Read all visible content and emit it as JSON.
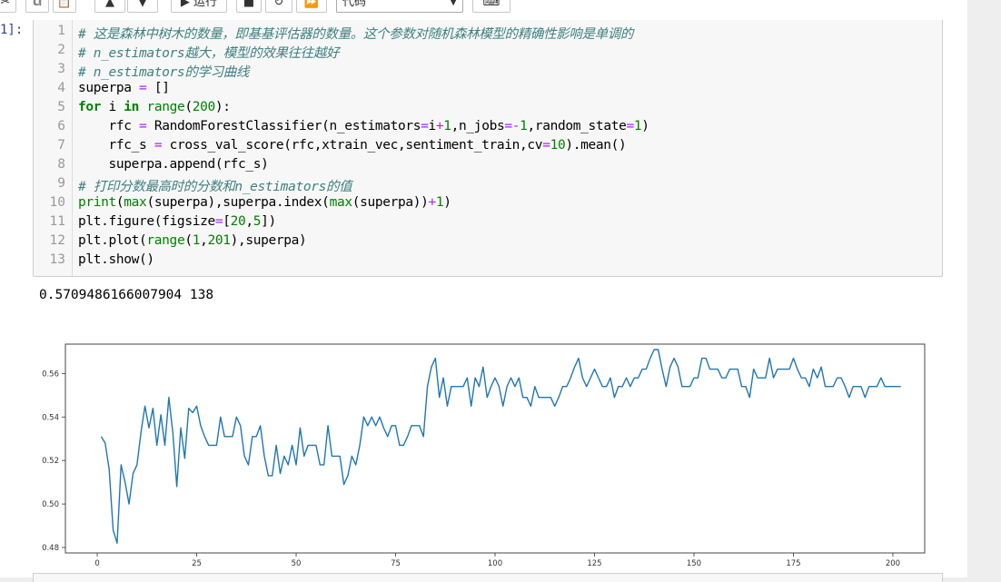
{
  "toolbar": {
    "run_label": "▶ 运行",
    "celltype_value": "代码",
    "buttons": [
      "cut-icon",
      "copy-icon",
      "paste-icon",
      "move-up-icon",
      "move-down-icon",
      "run",
      "stop-icon",
      "restart-icon",
      "fast-forward-icon",
      "keyboard-icon"
    ]
  },
  "cell": {
    "prompt": "1]:",
    "line_numbers": [
      "1",
      "2",
      "3",
      "4",
      "5",
      "6",
      "7",
      "8",
      "9",
      "10",
      "11",
      "12",
      "13"
    ],
    "code_lines": [
      "# 这是森林中树木的数量，即基基评估器的数量。这个参数对随机森林模型的精确性影响是单调的",
      "# n_estimators越大，模型的效果往往越好",
      "# n_estimators的学习曲线",
      "superpa = []",
      "for i in range(200):",
      "    rfc = RandomForestClassifier(n_estimators=i+1,n_jobs=-1,random_state=1)",
      "    rfc_s = cross_val_score(rfc,xtrain_vec,sentiment_train,cv=10).mean()",
      "    superpa.append(rfc_s)",
      "# 打印分数最高时的分数和n_estimators的值",
      "print(max(superpa),superpa.index(max(superpa))+1)",
      "plt.figure(figsize=[20,5])",
      "plt.plot(range(1,201),superpa)",
      "plt.show()"
    ],
    "output_text": "0.5709486166007904 138"
  },
  "chart_data": {
    "type": "line",
    "title": "",
    "xlabel": "",
    "ylabel": "",
    "xlim": [
      -8,
      208
    ],
    "ylim": [
      0.4775,
      0.5735
    ],
    "xticks": [
      "0",
      "25",
      "50",
      "75",
      "100",
      "125",
      "150",
      "175",
      "200"
    ],
    "yticks": [
      "0.48",
      "0.50",
      "0.52",
      "0.54",
      "0.56"
    ],
    "grid": false,
    "line_color": "#1f77b4",
    "series": [
      {
        "x_start": 1,
        "x_step": 1,
        "values": [
          0.531,
          0.528,
          0.516,
          0.488,
          0.482,
          0.518,
          0.51,
          0.5,
          0.514,
          0.518,
          0.533,
          0.545,
          0.535,
          0.544,
          0.527,
          0.541,
          0.527,
          0.549,
          0.533,
          0.508,
          0.535,
          0.521,
          0.544,
          0.542,
          0.545,
          0.536,
          0.531,
          0.527,
          0.527,
          0.527,
          0.54,
          0.531,
          0.531,
          0.531,
          0.54,
          0.536,
          0.522,
          0.518,
          0.531,
          0.531,
          0.536,
          0.522,
          0.513,
          0.513,
          0.527,
          0.514,
          0.522,
          0.518,
          0.527,
          0.518,
          0.535,
          0.522,
          0.527,
          0.527,
          0.527,
          0.518,
          0.518,
          0.536,
          0.522,
          0.522,
          0.522,
          0.509,
          0.513,
          0.522,
          0.518,
          0.527,
          0.54,
          0.536,
          0.54,
          0.536,
          0.54,
          0.535,
          0.531,
          0.536,
          0.536,
          0.527,
          0.527,
          0.531,
          0.536,
          0.536,
          0.536,
          0.531,
          0.554,
          0.563,
          0.567,
          0.549,
          0.558,
          0.545,
          0.554,
          0.554,
          0.554,
          0.554,
          0.558,
          0.545,
          0.558,
          0.554,
          0.563,
          0.549,
          0.554,
          0.558,
          0.554,
          0.545,
          0.554,
          0.558,
          0.554,
          0.558,
          0.549,
          0.549,
          0.545,
          0.554,
          0.549,
          0.549,
          0.549,
          0.549,
          0.545,
          0.549,
          0.554,
          0.554,
          0.558,
          0.563,
          0.567,
          0.558,
          0.554,
          0.558,
          0.562,
          0.558,
          0.554,
          0.554,
          0.558,
          0.549,
          0.554,
          0.554,
          0.558,
          0.554,
          0.558,
          0.558,
          0.562,
          0.562,
          0.567,
          0.571,
          0.571,
          0.562,
          0.554,
          0.563,
          0.567,
          0.563,
          0.554,
          0.554,
          0.554,
          0.558,
          0.558,
          0.567,
          0.567,
          0.562,
          0.562,
          0.562,
          0.558,
          0.558,
          0.562,
          0.562,
          0.562,
          0.554,
          0.554,
          0.549,
          0.562,
          0.558,
          0.558,
          0.558,
          0.567,
          0.558,
          0.562,
          0.562,
          0.562,
          0.562,
          0.567,
          0.562,
          0.558,
          0.558,
          0.554,
          0.562,
          0.558,
          0.563,
          0.554,
          0.554,
          0.554,
          0.558,
          0.558,
          0.554,
          0.549,
          0.554,
          0.554,
          0.554,
          0.549,
          0.554,
          0.554,
          0.554,
          0.558,
          0.554,
          0.554,
          0.554,
          0.554,
          0.554
        ]
      }
    ]
  }
}
